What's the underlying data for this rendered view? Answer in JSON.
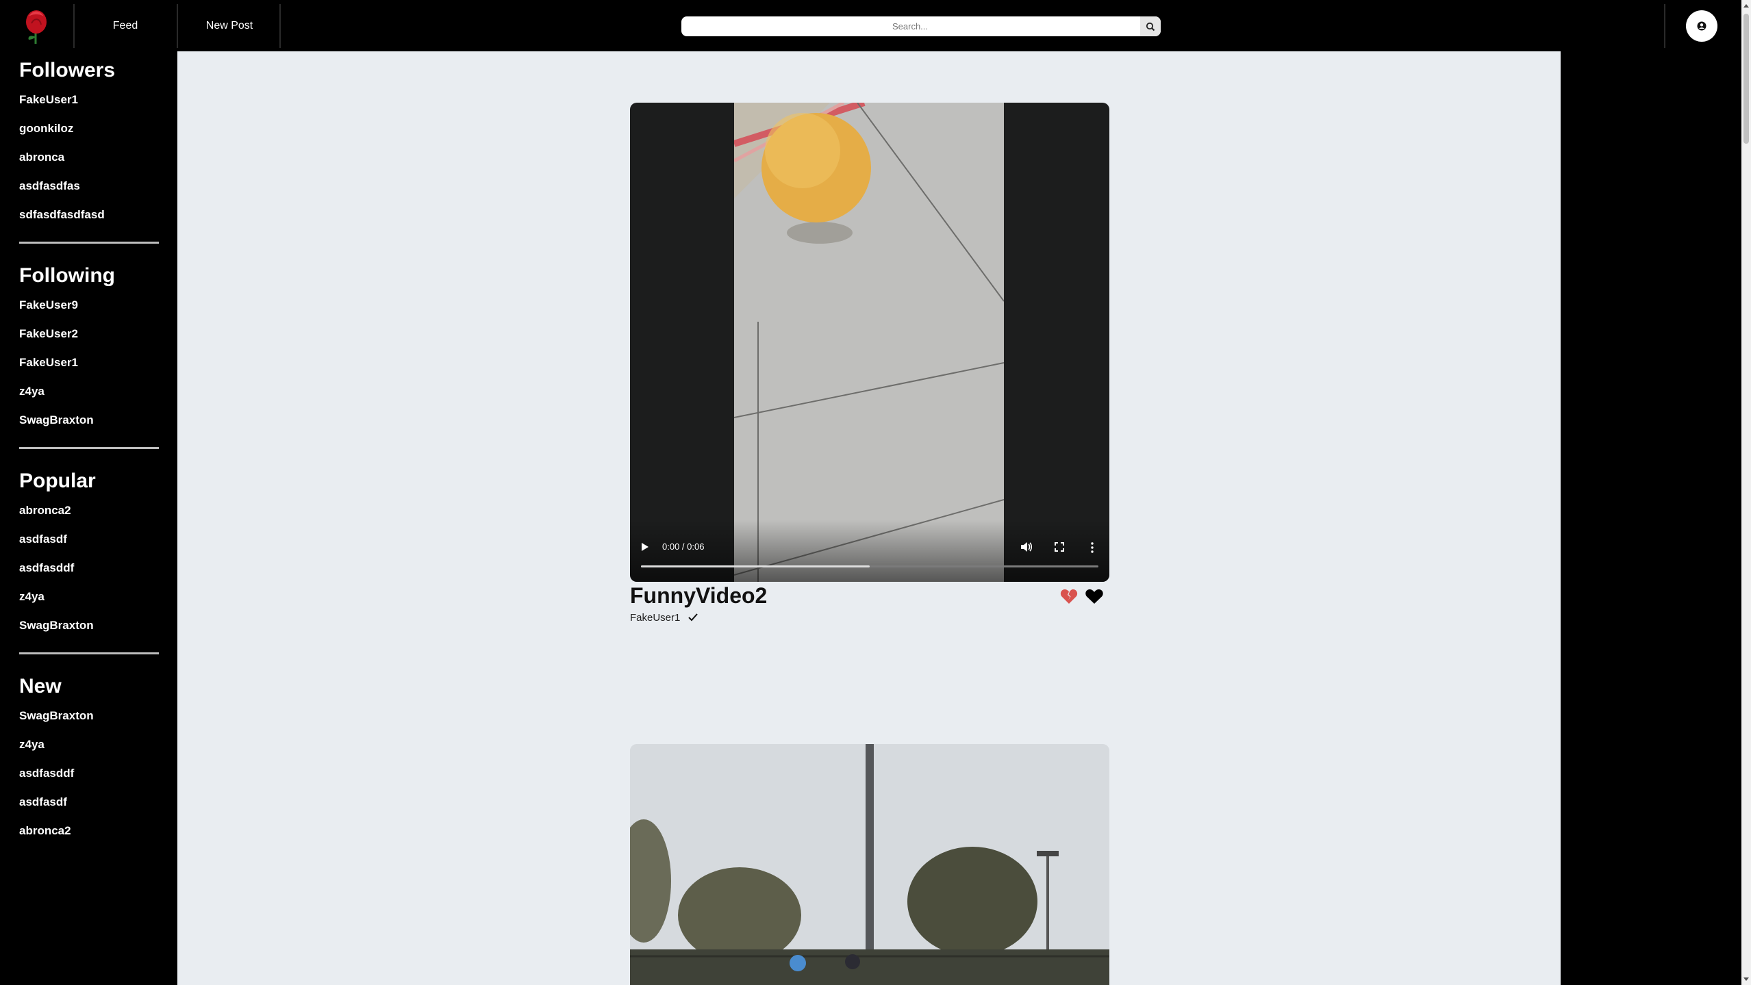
{
  "nav": {
    "feed_label": "Feed",
    "new_post_label": "New Post",
    "search_placeholder": "Search..."
  },
  "sidebar": {
    "followers": {
      "title": "Followers",
      "items": [
        "FakeUser1",
        "goonkiloz",
        "abronca",
        "asdfasdfas",
        "sdfasdfasdfasd"
      ]
    },
    "following": {
      "title": "Following",
      "items": [
        "FakeUser9",
        "FakeUser2",
        "FakeUser1",
        "z4ya",
        "SwagBraxton"
      ]
    },
    "popular": {
      "title": "Popular",
      "items": [
        "abronca2",
        "asdfasdf",
        "asdfasddf",
        "z4ya",
        "SwagBraxton"
      ]
    },
    "new": {
      "title": "New",
      "items": [
        "SwagBraxton",
        "z4ya",
        "asdfasddf",
        "asdfasdf",
        "abronca2"
      ]
    }
  },
  "post": {
    "title": "FunnyVideo2",
    "author": "FakeUser1",
    "time": "0:00 / 0:06",
    "progress": 0.5
  },
  "colors": {
    "nav_bg": "#000000",
    "page_bg": "#e9edf1",
    "dislike": "#d9534f"
  }
}
